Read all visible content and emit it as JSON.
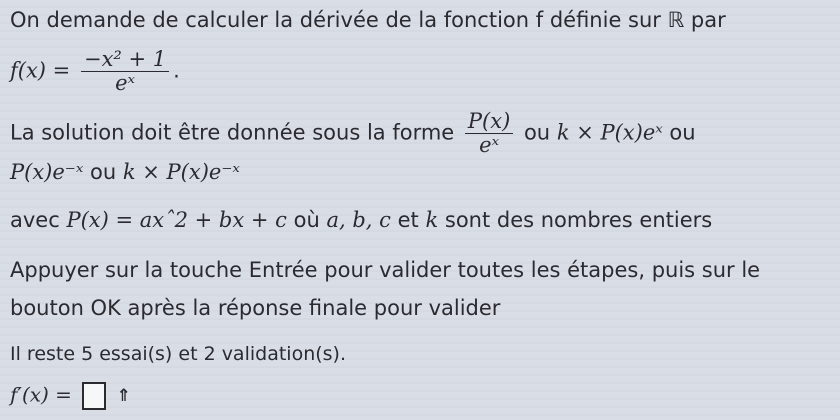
{
  "intro": {
    "text": "On demande de calculer la dérivée de la fonction f définie sur ℝ par"
  },
  "function": {
    "lhs": "f(x) =",
    "numerator": "−x² + 1",
    "denominator": "eˣ",
    "end": "."
  },
  "form_line1": {
    "prefix": "La solution doit être donnée sous la forme",
    "frac_num": "P(x)",
    "frac_den": "eˣ",
    "ou1": "ou",
    "form2": "k × P(x)eˣ",
    "ou2": "ou"
  },
  "form_line2": {
    "form3": "P(x)e⁻ˣ",
    "ou": "ou",
    "form4": "k × P(x)e⁻ˣ"
  },
  "constraint": {
    "prefix": "avec",
    "poly": "P(x) = axˆ2 + bx + c",
    "mid": "où",
    "vars": "a, b, c",
    "et": "et",
    "k": "k",
    "suffix": "sont des nombres entiers"
  },
  "instruction": {
    "line1": "Appuyer sur la touche Entrée pour valider toutes les étapes, puis sur le",
    "line2": "bouton OK après la réponse finale pour valider"
  },
  "status": {
    "text": "Il reste 5 essai(s) et 2 validation(s)."
  },
  "answer": {
    "label": "f′(x) =",
    "value": "",
    "submit_icon": "⇑"
  }
}
